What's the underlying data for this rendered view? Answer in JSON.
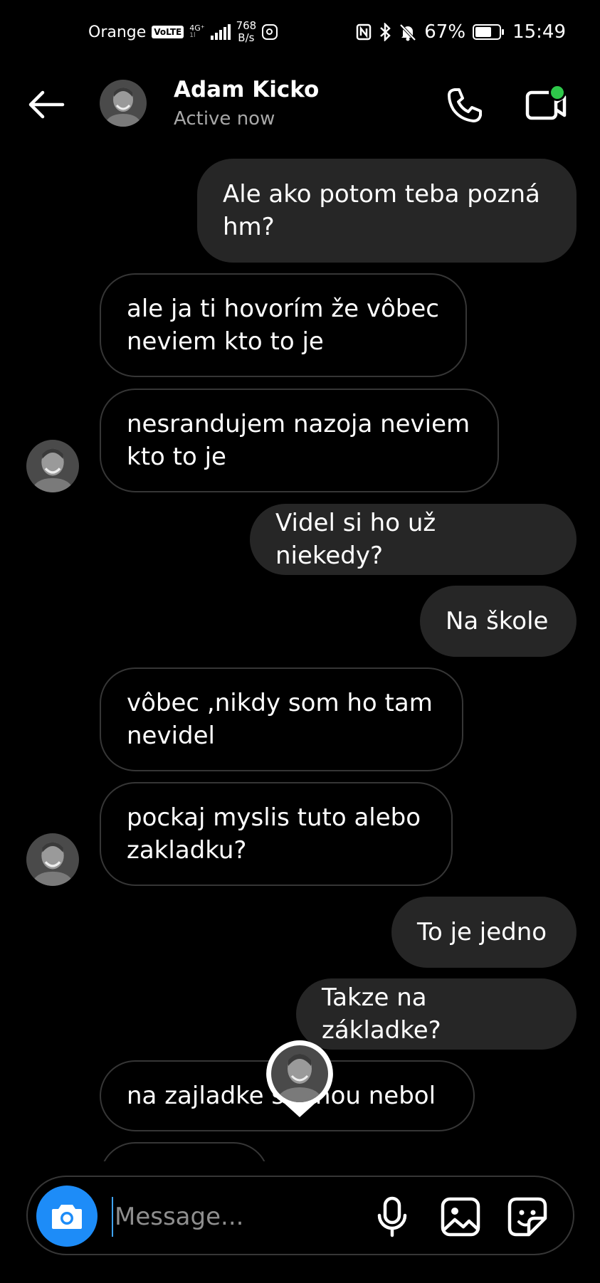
{
  "status_bar": {
    "carrier": "Orange",
    "volte": "VoLTE",
    "network": "4G⁺",
    "network_sub": "1l",
    "speed_value": "768",
    "speed_unit": "B/s",
    "battery": "67%",
    "time": "15:49"
  },
  "header": {
    "name": "Adam Kicko",
    "status": "Active now"
  },
  "messages": [
    {
      "sender": "me",
      "text": "Ale ako potom teba pozná hm?"
    },
    {
      "sender": "them",
      "text": "ale ja ti hovorím že vôbec neviem kto to je"
    },
    {
      "sender": "them",
      "text": "nesrandujem nazoja neviem kto to je"
    },
    {
      "sender": "me",
      "text": "Videl si ho už niekedy?"
    },
    {
      "sender": "me",
      "text": "Na škole"
    },
    {
      "sender": "them",
      "text": "vôbec ,nikdy som ho tam nevidel"
    },
    {
      "sender": "them",
      "text": "pockaj myslis tuto alebo zakladku?"
    },
    {
      "sender": "me",
      "text": "To je jedno"
    },
    {
      "sender": "me",
      "text": "Takze na základke?"
    },
    {
      "sender": "them",
      "text": "na zajladke s mnou nebol"
    }
  ],
  "composer": {
    "placeholder": "Message..."
  },
  "colors": {
    "background": "#000000",
    "outgoing_bubble": "#262626",
    "incoming_border": "#363636",
    "camera_button": "#1d8cf8",
    "active_dot": "#2ec84a"
  },
  "icons": [
    "back-arrow-icon",
    "phone-icon",
    "video-call-icon",
    "camera-icon",
    "microphone-icon",
    "gallery-icon",
    "sticker-icon"
  ]
}
